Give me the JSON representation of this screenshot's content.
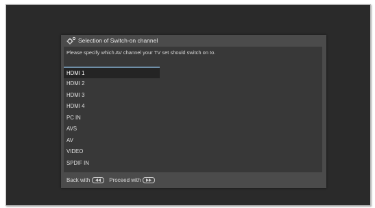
{
  "dialog": {
    "title": "Selection of Switch-on channel",
    "prompt": "Please specify which AV channel your TV set should switch on to."
  },
  "channels": [
    "HDMI 1",
    "HDMI 2",
    "HDMI 3",
    "HDMI 4",
    "PC IN",
    "AVS",
    "AV",
    "VIDEO",
    "SPDIF IN"
  ],
  "selected_channel": "HDMI 1",
  "footer": {
    "back_label": "Back with",
    "proceed_label": "Proceed with"
  },
  "icons": {
    "title": "settings-gear-icon",
    "back": "rewind-button-icon",
    "proceed": "fast-forward-button-icon"
  }
}
